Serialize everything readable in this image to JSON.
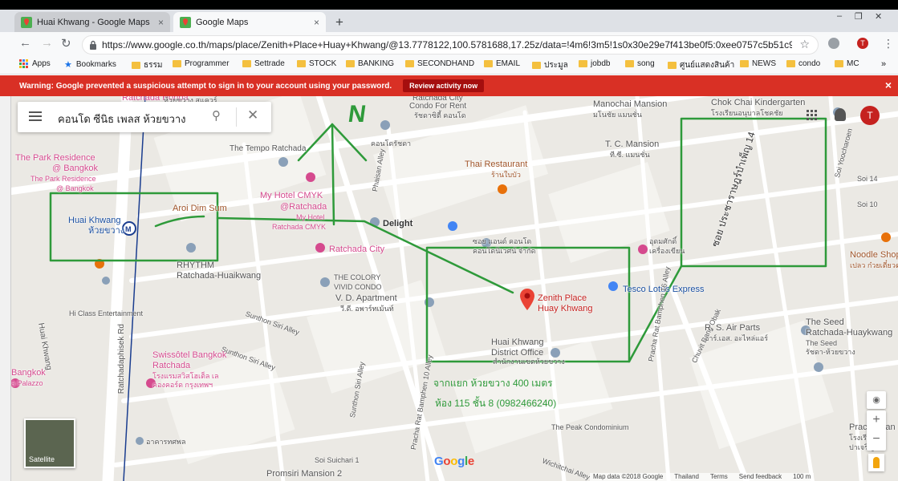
{
  "browser": {
    "tabs": [
      {
        "title": "Huai Khwang - Google Maps",
        "close": "×"
      },
      {
        "title": "Google Maps",
        "close": "×"
      }
    ],
    "new_tab": "+",
    "window_controls": {
      "minimize": "–",
      "restore": "❐",
      "close": "✕"
    },
    "url": "https://www.google.co.th/maps/place/Zenith+Place+Huay+Khwang/@13.7778122,100.5781688,17.25z/data=!4m6!3m5!1s0x30e29e7f413be0f5:0xee0757c5b51c97ee!4b1...",
    "avatar_letter": "T"
  },
  "bookmarks": [
    {
      "label": "Apps",
      "type": "apps"
    },
    {
      "label": "Bookmarks",
      "type": "star"
    },
    {
      "label": "ธรรม",
      "type": "folder"
    },
    {
      "label": "Programmer",
      "type": "folder"
    },
    {
      "label": "Settrade",
      "type": "folder"
    },
    {
      "label": "STOCK",
      "type": "folder"
    },
    {
      "label": "BANKING",
      "type": "folder"
    },
    {
      "label": "SECONDHAND",
      "type": "folder"
    },
    {
      "label": "EMAIL",
      "type": "folder"
    },
    {
      "label": "ประมูล",
      "type": "folder"
    },
    {
      "label": "jobdb",
      "type": "folder"
    },
    {
      "label": "song",
      "type": "folder"
    },
    {
      "label": "ศูนย์แสดงสินค้า",
      "type": "folder"
    },
    {
      "label": "NEWS",
      "type": "folder"
    },
    {
      "label": "condo",
      "type": "folder"
    },
    {
      "label": "MC",
      "type": "folder"
    }
  ],
  "warning": {
    "text": "Warning: Google prevented a suspicious attempt to sign in to your account using your password.",
    "action": "Review activity now",
    "close": "×"
  },
  "map": {
    "search_query": "คอนโด ซีนิธ เพลส ห้วยขวาง",
    "avatar_letter": "T",
    "satellite_label": "Satellite",
    "google_logo": "Google",
    "footer": [
      "Map data ©2018 Google",
      "Thailand",
      "Terms",
      "Send feedback",
      "100 m"
    ],
    "labels": {
      "ratchada_honpa": "Ratchada Honpa",
      "huai_khwang_top": "ห้วยขวาง สแควร์",
      "ratchada_city_top": "Ratchada City",
      "condo_for_rent": "Condo For Rent",
      "condo_for_rent_th": "รัชดาซิตี้ คอนโด",
      "manochai": "Manochai Mansion",
      "manochai_th": "มโนชัย แมนชั่น",
      "chokchai": "Chok Chai Kindergarten",
      "chokchai_th": "โรงเรียนอนุบาลโชคชัย",
      "park_res_1": "The Park Residence",
      "park_res_2": "@ Bangkok",
      "park_res_3": "The Park Residence",
      "park_res_4": "@ Bangkok",
      "tempo": "The Tempo Ratchada",
      "condo_th": "คอนโดรัชดา",
      "tc_mansion": "T. C. Mansion",
      "tc_mansion_th": "ที.ซี. แมนชั่น",
      "thai_rest": "Thai Restaurant",
      "thai_rest_th": "ร้านใบบัว",
      "mycmyk_1": "My Hotel CMYK",
      "mycmyk_2": "@Ratchada",
      "mycmyk_3": "My Hotel",
      "mycmyk_4": "Ratchada CMYK",
      "aroi": "Aroi Dim Sum",
      "huai_khwang": "Huai Khwang",
      "huai_khwang_th": "ห้วยขวาง",
      "delight": "Delight",
      "rhythm_1": "RHYTHM",
      "rhythm_2": "Ratchada-Huaikwang",
      "ratchada_city": "Ratchada City",
      "colory_1": "THE COLORY",
      "colory_2": "VIVID CONDO",
      "vd_apartment": "V. D. Apartment",
      "vd_apartment_th": "วี.ดี. อพาร์ทเม้นท์",
      "zenith_1": "Zenith Place",
      "zenith_2": "Huay Khwang",
      "tesco": "Tesco Lotus Express",
      "condo_and": "ซอย แอนด์ คอนโด",
      "condo_and_2": "คอนโดนิเวศน์ จำกัด",
      "udomsuk": "อุดมศักดิ์",
      "udomsuk_2": "เครื่องเขียน",
      "hi_class": "Hi Class Entertainment",
      "huai_khwang_road": "Huai Khwang",
      "ratchada_pisek": "Ratchadaphisek Rd",
      "sunthon_1": "Sunthon Siri Alley",
      "sunthon_2": "Sunthon Siri Alley",
      "sunthon_3": "Sunthon Siri Alley",
      "phaisan": "Phaisan Alley",
      "pracha_1": "Pracha Rat Bamphen 10 Alley",
      "pracha_2": "Pracha Rat Bamphen 16 Alley",
      "district_1": "Huai Khwang",
      "district_2": "District Office",
      "district_th": "สำนักงานเขตห้วยขวาง",
      "swiss_1": "Swissôtel Bangkok",
      "swiss_2": "Ratchada",
      "swiss_th_1": "โรงแรมสวิสโฮเต็ล เล",
      "swiss_th_2": "คองคอร์ด กรุงเทพฯ",
      "bangkok_l": "Bangkok",
      "palazzo": "a Palazzo",
      "artsed": "อาคารทศพล",
      "soi_suichar": "Soi Suichari 1",
      "promsiri": "Promsiri Mansion 2",
      "peak": "The Peak Condominium",
      "wichit": "Wichitchai Alley",
      "chuvit": "Chuvit Bang Obak",
      "rs_air": "R. S. Air Parts",
      "rs_air_th": "อาร์.เอส. อะไหล่แอร์",
      "seed_1": "The Seed",
      "seed_2": "Ratchada-Huaykwang",
      "seed_3": "The Seed",
      "seed_4": "รัชดา-ห้วยขวาง",
      "noodle": "Noodle Shop",
      "noodle_th": "เปลว ก๋วยเตี๋ยวต",
      "soi_10": "Soi 10",
      "soi_14": "Soi 14",
      "soi_yoo": "Soi Yoocharoen",
      "pracha_ban_1": "Pracha",
      "pracha_ban_2": "Ban",
      "pracha_ban_3": "โรงเรียน",
      "pracha_ban_4": "ปาเจริญ",
      "soi_th_14": "ซอย ประชาราษฎร์บำเพ็ญ 14"
    },
    "annotation": {
      "north": "N",
      "note_line_1": "จากแยก ห้วยขวาง 400 เมตร",
      "note_line_2": "ห้อง 115 ชั้น 8 (0982466240)",
      "color": "#2e9a3a"
    }
  },
  "colors": {
    "warning_bg": "#d93025",
    "marker_red": "#ea4335",
    "annotation_green": "#2e9a3a"
  }
}
